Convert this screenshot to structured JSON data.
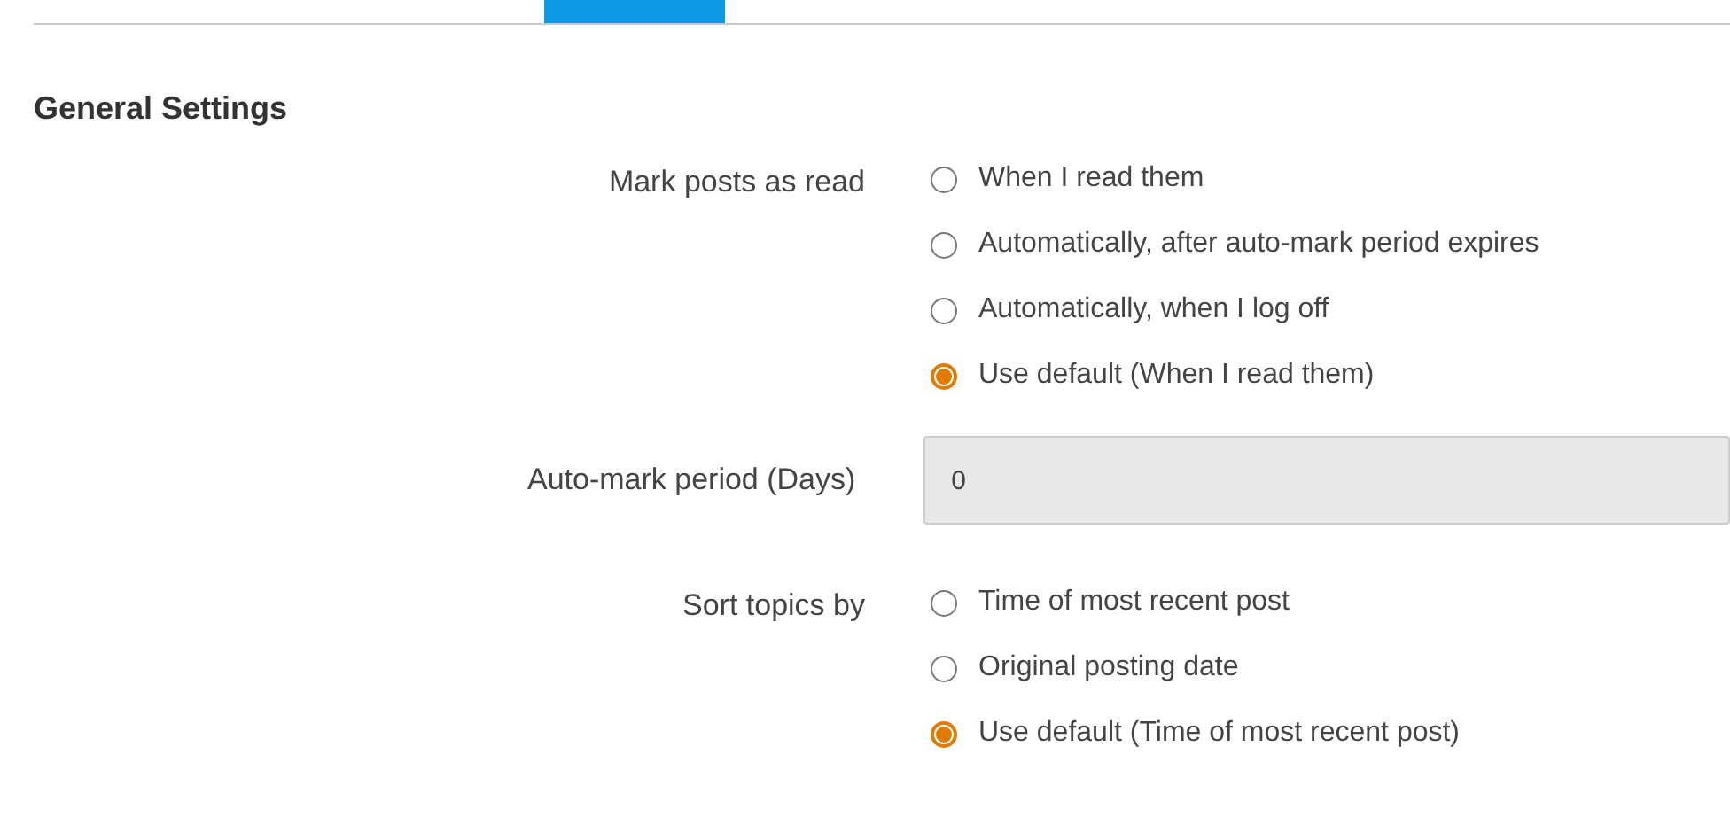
{
  "section": {
    "title": "General Settings"
  },
  "fields": [
    {
      "kind": "radio",
      "label": "Mark posts as read",
      "options": [
        {
          "label": "When I read them",
          "selected": false
        },
        {
          "label": "Automatically, after auto-mark period expires",
          "selected": false
        },
        {
          "label": "Automatically, when I log off",
          "selected": false
        },
        {
          "label": "Use default (When I read them)",
          "selected": true
        }
      ]
    },
    {
      "kind": "input",
      "label": "Auto-mark period (Days)",
      "value": "0",
      "disabled": true
    },
    {
      "kind": "radio",
      "label": "Sort topics by",
      "options": [
        {
          "label": "Time of most recent post",
          "selected": false
        },
        {
          "label": "Original posting date",
          "selected": false
        },
        {
          "label": "Use default (Time of most recent post)",
          "selected": true
        }
      ]
    }
  ]
}
